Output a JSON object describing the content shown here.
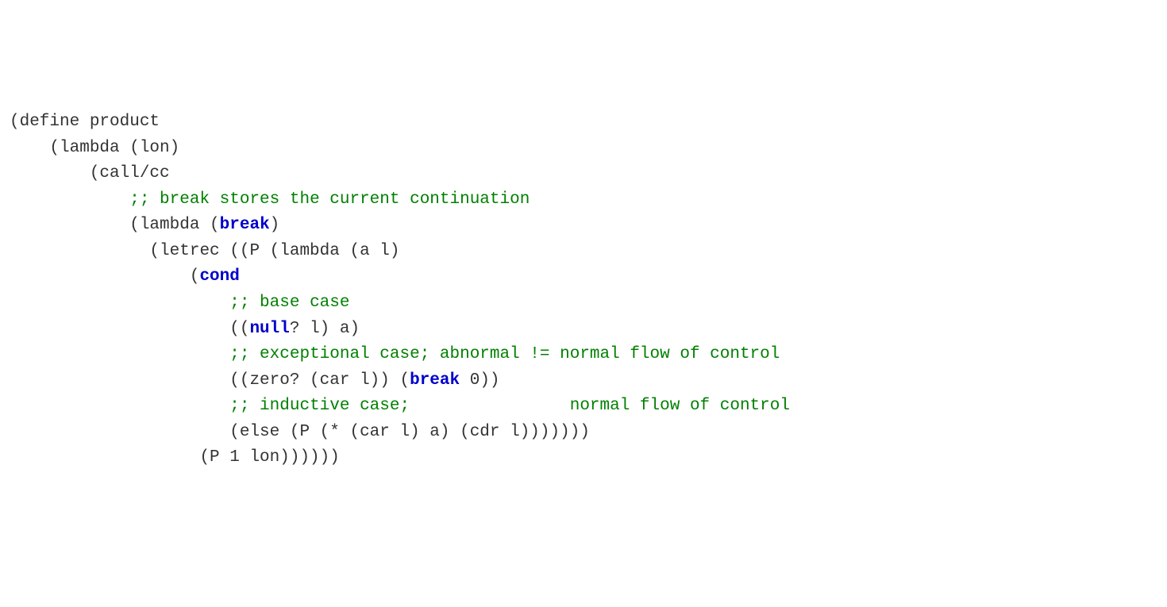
{
  "code": {
    "l1": {
      "a": "(define product"
    },
    "l2": {
      "a": "    (lambda (lon)"
    },
    "l3": {
      "a": "        (call/cc"
    },
    "l4": {
      "a": "            ",
      "b": ";; break stores the current continuation"
    },
    "l5": {
      "a": "            (lambda (",
      "b": "break",
      "c": ")"
    },
    "l6": {
      "a": "              (letrec ((P (lambda (a l)"
    },
    "l7": {
      "a": "                  (",
      "b": "cond"
    },
    "l8": {
      "a": "                      ",
      "b": ";; base case"
    },
    "l9": {
      "a": "                      ((",
      "b": "null",
      "c": "? l) a)"
    },
    "l10": {
      "a": "                      ",
      "b": ";; exceptional case; abnormal != normal flow of control"
    },
    "l11": {
      "a": "                      ((zero? (car l)) (",
      "b": "break",
      "c": " 0))"
    },
    "l12": {
      "a": "                      ",
      "b": ";; inductive case;                normal flow of control"
    },
    "l13": {
      "a": "                      (else (P (* (car l) a) (cdr l)))))))"
    },
    "l14": {
      "a": "                   (P 1 lon))))))"
    }
  }
}
